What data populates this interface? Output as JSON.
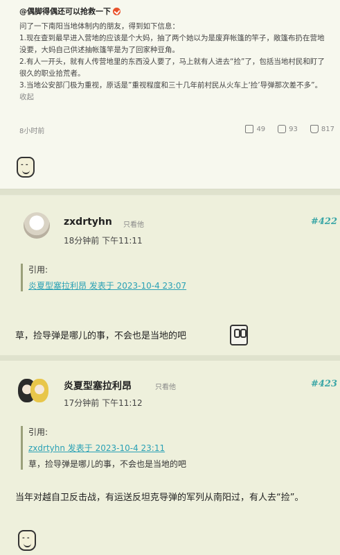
{
  "weibo": {
    "author": "@偶脚得偶还可以抢救一下",
    "paragraphs": [
      "问了一下南阳当地体制内的朋友，得到如下信息：",
      "1.现在查到最早进入营地的应该是个大妈，抽了两个她以为是废弃帐篷的竿子，敞篷布扔在营地没要，大妈自己供述抽帐篷竿是为了回家种豆角。",
      "2.有人一开头，就有人传营地里的东西没人要了，马上就有人进去“捡”了，包括当地村民和盯了很久的职业拾荒者。",
      "3.当地公安部门极为重视，原话是”重视程度和三十几年前村民从火车上‘捡’导弹那次差不多”。"
    ],
    "collapse_label": "收起",
    "time": "8小时前",
    "shares": "49",
    "comments": "93",
    "likes": "817"
  },
  "post1": {
    "username": "zxdrtyhn",
    "only_label": "只看他",
    "time": "18分钟前  下午11:11",
    "floor": "#422",
    "quote_label": "引用:",
    "quote_link": "炎夏型塞拉利昂 发表于 2023-10-4 23:07",
    "text": "草，捡导弹是哪儿的事，不会也是当地的吧"
  },
  "post2": {
    "username": "炎夏型塞拉利昂",
    "only_label": "只看他",
    "time": "17分钟前  下午11:12",
    "floor": "#423",
    "quote_label": "引用:",
    "quote_link": "zxdrtyhn 发表于 2023-10-4 23:11",
    "quote_text": "草，捡导弹是哪儿的事，不会也是当地的吧",
    "text": "当年对越自卫反击战，有运送反坦克导弹的军列从南阳过，有人去“捡”。"
  }
}
